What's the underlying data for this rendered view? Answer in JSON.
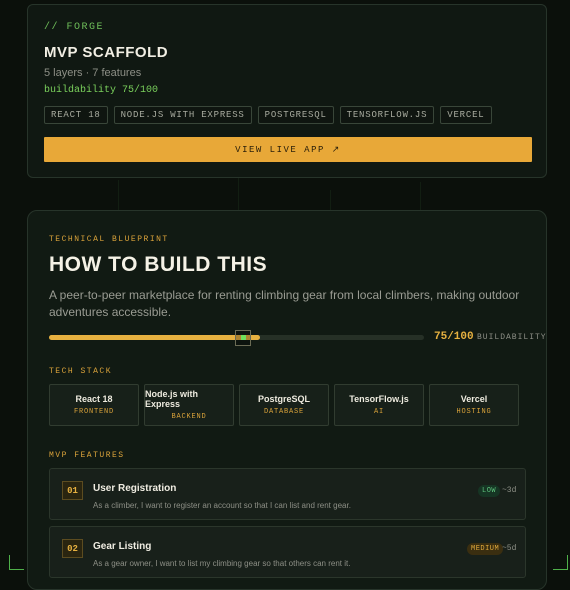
{
  "forge": {
    "label": "// FORGE",
    "title": "MVP SCAFFOLD",
    "subtitle": "5 layers · 7 features",
    "buildability": "buildability 75/100",
    "tags": [
      "REACT 18",
      "NODE.JS WITH EXPRESS",
      "POSTGRESQL",
      "TENSORFLOW.JS",
      "VERCEL"
    ],
    "cta_label": "VIEW LIVE APP ↗"
  },
  "blueprint": {
    "label": "TECHNICAL BLUEPRINT",
    "title": "HOW TO BUILD THIS",
    "description": "A peer-to-peer marketplace for renting climbing gear from local climbers, making outdoor adventures accessible.",
    "score": 75,
    "score_max": 100,
    "score_text": "75/100",
    "score_caption": "BUILDABILITY"
  },
  "tech_stack": {
    "label": "TECH STACK",
    "items": [
      {
        "name": "React 18",
        "role": "FRONTEND"
      },
      {
        "name": "Node.js with Express",
        "role": "BACKEND"
      },
      {
        "name": "PostgreSQL",
        "role": "DATABASE"
      },
      {
        "name": "TensorFlow.js",
        "role": "AI"
      },
      {
        "name": "Vercel",
        "role": "HOSTING"
      }
    ]
  },
  "features": {
    "label": "MVP FEATURES",
    "items": [
      {
        "num": "01",
        "title": "User Registration",
        "desc": "As a climber, I want to register an account so that I can list and rent gear.",
        "level": "LOW",
        "time": "~3d"
      },
      {
        "num": "02",
        "title": "Gear Listing",
        "desc": "As a gear owner, I want to list my climbing gear so that others can rent it.",
        "level": "MEDIUM",
        "time": "~5d"
      }
    ]
  },
  "colors": {
    "accent": "#e8a838",
    "green": "#6fbf5a",
    "background": "#0b100b"
  }
}
